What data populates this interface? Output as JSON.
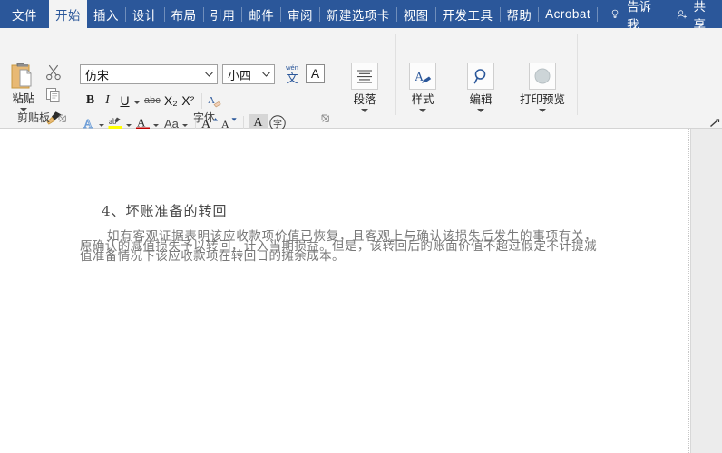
{
  "ribbon": {
    "tabs": [
      {
        "label": "文件",
        "active": false
      },
      {
        "label": "开始",
        "active": true
      },
      {
        "label": "插入",
        "active": false
      },
      {
        "label": "设计",
        "active": false
      },
      {
        "label": "布局",
        "active": false
      },
      {
        "label": "引用",
        "active": false
      },
      {
        "label": "邮件",
        "active": false
      },
      {
        "label": "审阅",
        "active": false
      },
      {
        "label": "新建选项卡",
        "active": false
      },
      {
        "label": "视图",
        "active": false
      },
      {
        "label": "开发工具",
        "active": false
      },
      {
        "label": "帮助",
        "active": false
      },
      {
        "label": "Acrobat",
        "active": false
      }
    ],
    "tell_me": "告诉我",
    "share": "共享"
  },
  "clipboard": {
    "group_label": "剪贴板",
    "paste_label": "粘贴",
    "cut_name": "剪切",
    "copy_name": "复制",
    "format_painter_name": "格式刷"
  },
  "font": {
    "group_label": "字体",
    "font_name_value": "仿宋",
    "font_size_value": "小四",
    "phonetic_pinyin": "wén",
    "phonetic_char": "文",
    "char_border_glyph": "A",
    "bold": "B",
    "italic": "I",
    "underline": "U",
    "strikethrough": "abc",
    "subscript": "X₂",
    "superscript": "X²",
    "clear_format": "A",
    "text_effects": "A",
    "highlight": "ab",
    "font_color": "A",
    "change_case": "Aa",
    "grow_font": "A",
    "shrink_font": "A",
    "char_shading": "A",
    "enclose_char": "字"
  },
  "groups": [
    {
      "label": "段落",
      "icon": "paragraph-align-icon"
    },
    {
      "label": "样式",
      "icon": "styles-icon"
    },
    {
      "label": "编辑",
      "icon": "search-icon"
    },
    {
      "label": "打印预览",
      "icon": "print-preview-icon"
    }
  ],
  "document": {
    "heading": "4、坏账准备的转回",
    "paragraph": "如有客观证据表明该应收款项价值已恢复，且客观上与确认该损失后发生的事项有关，原确认的减值损失予以转回，计入当期损益。但是，该转回后的账面价值不超过假定不计提减值准备情况下该应收款项在转回日的摊余成本。"
  },
  "colors": {
    "ribbon_blue": "#2b579a",
    "ribbon_bg": "#f3f3f3",
    "accent_orange": "#e8b974",
    "highlight_yellow": "#ffff00",
    "font_color_red": "#c00000"
  }
}
